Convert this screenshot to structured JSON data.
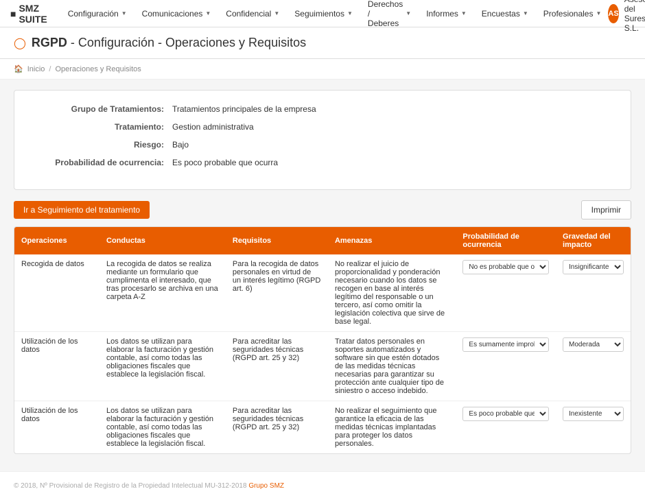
{
  "brand": {
    "name": "SMZ SUITE"
  },
  "navbar": {
    "items": [
      {
        "label": "Configuración",
        "has_arrow": true
      },
      {
        "label": "Comunicaciones",
        "has_arrow": true
      },
      {
        "label": "Confidencial",
        "has_arrow": true
      },
      {
        "label": "Seguimientos",
        "has_arrow": true
      },
      {
        "label": "Derechos / Deberes",
        "has_arrow": true
      },
      {
        "label": "Informes",
        "has_arrow": true
      },
      {
        "label": "Encuestas",
        "has_arrow": true
      },
      {
        "label": "Profesionales",
        "has_arrow": true
      }
    ],
    "company": "Asesoría del Sureste S.L.",
    "company_abbr": "AS"
  },
  "page_header": {
    "prefix": "RGPD",
    "title": " - Configuración - Operaciones y Requisitos"
  },
  "breadcrumb": {
    "home": "Inicio",
    "separator": "/",
    "current": "Operaciones y Requisitos"
  },
  "info": {
    "grupo_label": "Grupo de Tratamientos:",
    "grupo_value": "Tratamientos principales de la empresa",
    "tratamiento_label": "Tratamiento:",
    "tratamiento_value": "Gestion administrativa",
    "riesgo_label": "Riesgo:",
    "riesgo_value": "Bajo",
    "probabilidad_label": "Probabilidad de ocurrencia:",
    "probabilidad_value": "Es poco probable que ocurra"
  },
  "buttons": {
    "seguimiento": "Ir a Seguimiento del tratamiento",
    "imprimir": "Imprimir"
  },
  "table": {
    "headers": [
      "Operaciones",
      "Conductas",
      "Requisitos",
      "Amenazas",
      "Probabilidad de ocurrencia",
      "Gravedad del impacto"
    ],
    "rows": [
      {
        "operaciones": "Recogida de datos",
        "conductas": "La recogida de datos se realiza mediante un formulario que cumplimenta el interesado, que tras procesarlo se archiva en una carpeta A-Z",
        "requisitos": "Para la recogida de datos personales en virtud de un interés legítimo (RGPD art. 6)",
        "amenazas": "No realizar el juicio de proporcionalidad y ponderación necesario cuando los datos se recogen en base al interés legítimo del responsable o un tercero, así como omitir la legislación colectiva que sirve de base legal.",
        "probabilidad": "No es probable que ocurra",
        "gravedad": "Insignificante"
      },
      {
        "operaciones": "Utilización de los datos",
        "conductas": "Los datos se utilizan para elaborar la facturación y gestión contable, así como todas las obligaciones fiscales que establece la legislación fiscal.",
        "requisitos": "Para acreditar las seguridades técnicas (RGPD art. 25 y 32)",
        "amenazas": "Tratar datos personales en soportes automatizados y software sin que estén dotados de las medidas técnicas necesarias para garantizar su protección ante cualquier tipo de siniestro o acceso indebido.",
        "probabilidad": "Es sumamente improbable que ocurra",
        "gravedad": "Moderada"
      },
      {
        "operaciones": "Utilización de los datos",
        "conductas": "Los datos se utilizan para elaborar la facturación y gestión contable, así como todas las obligaciones fiscales que establece la legislación fiscal.",
        "requisitos": "Para acreditar las seguridades técnicas (RGPD art. 25 y 32)",
        "amenazas": "No realizar el seguimiento que garantice la eficacia de las medidas técnicas implantadas para proteger los datos personales.",
        "probabilidad": "Es poco probable que ocurra",
        "gravedad": "Inexistente"
      }
    ]
  },
  "footer": {
    "copyright": "© 2018, Nº Provisional de Registro de la Propiedad Intelectual MU-312-2018",
    "link_label": "Grupo SMZ"
  }
}
